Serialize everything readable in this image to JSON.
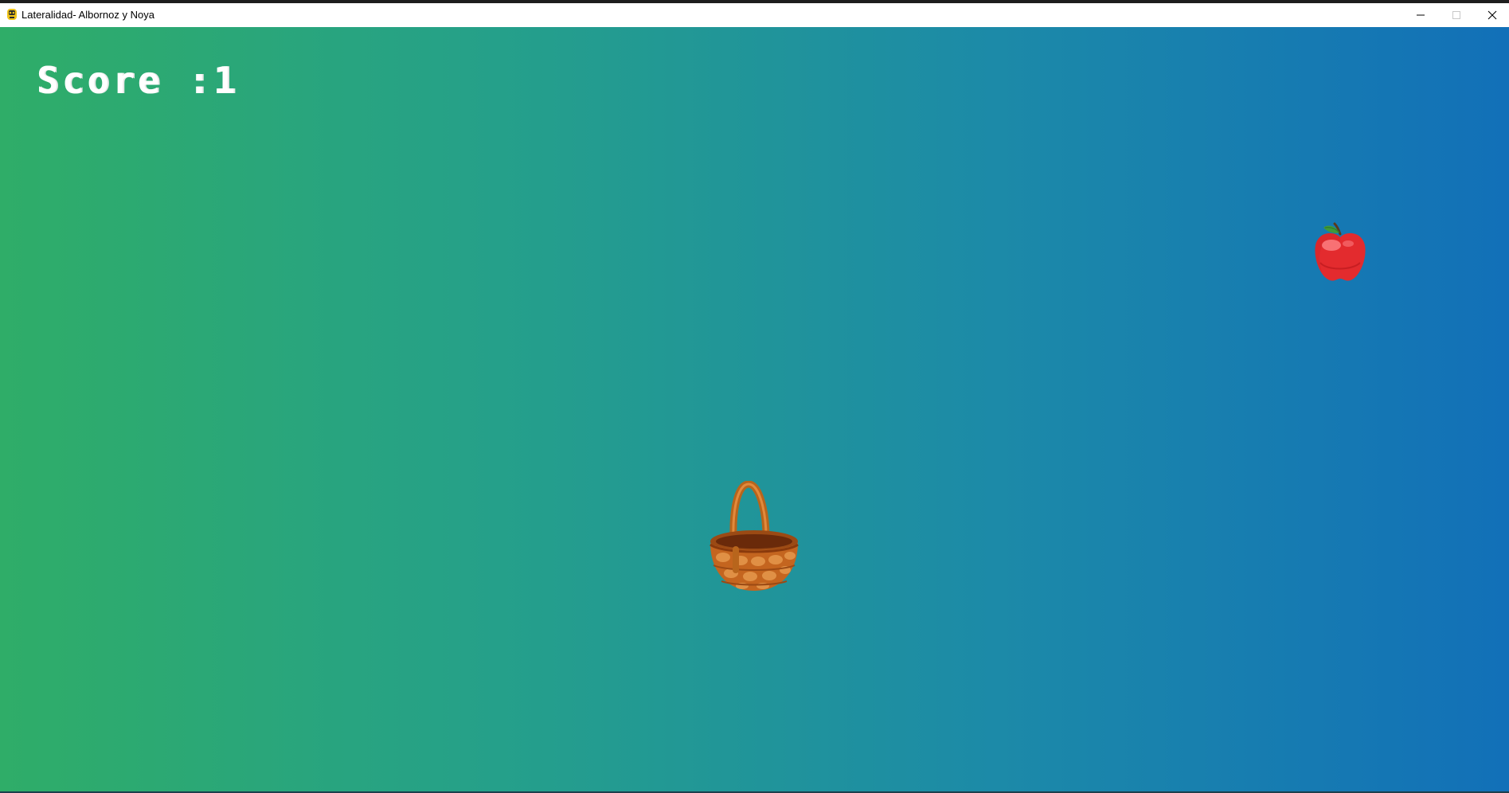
{
  "window": {
    "title": "Lateralidad- Albornoz y Noya",
    "app_icon": "pygame-snake-icon",
    "controls": {
      "minimize_icon": "minimize-icon",
      "maximize_icon": "maximize-icon",
      "close_icon": "close-icon"
    }
  },
  "game": {
    "score_text": "Score :1",
    "background_colors": [
      "#2fad68",
      "#25a08a",
      "#1c8aa8",
      "#1270b8"
    ],
    "sprites": {
      "falling_item": "apple-icon",
      "player": "basket-icon"
    }
  }
}
